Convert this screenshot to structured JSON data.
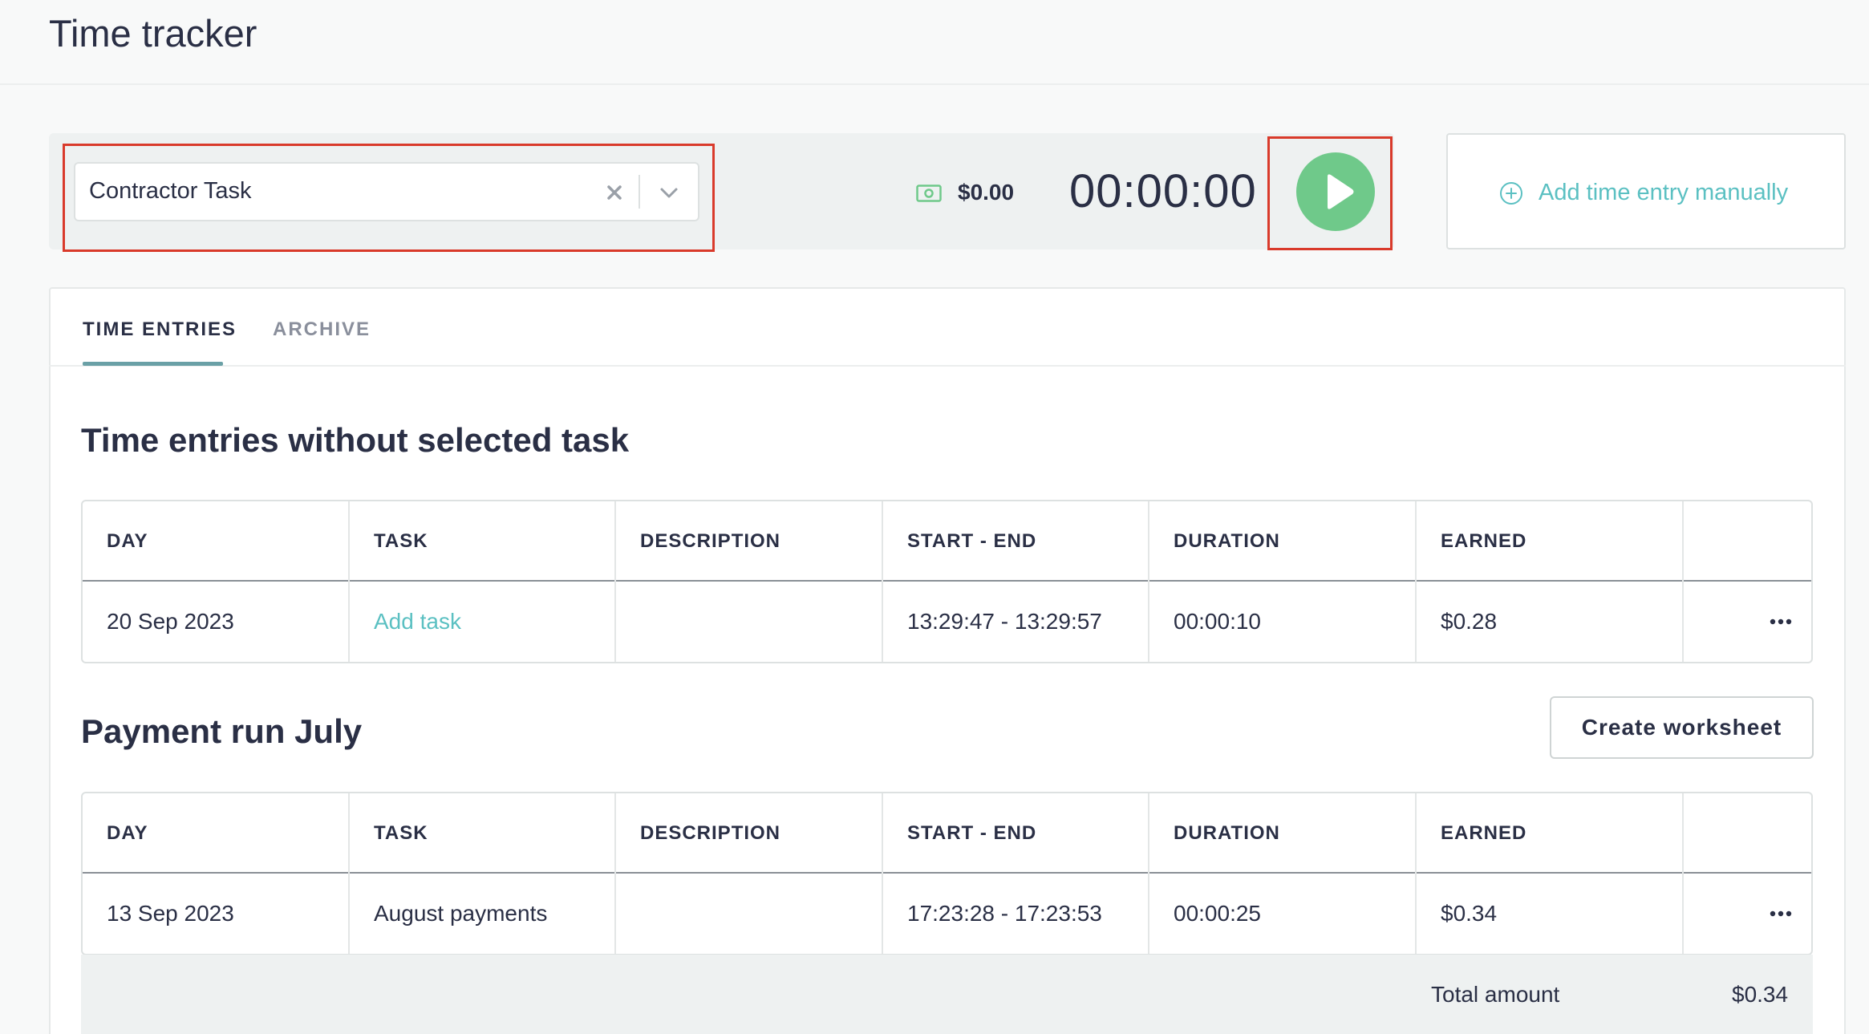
{
  "page": {
    "title": "Time tracker"
  },
  "timer": {
    "task_value": "Contractor Task",
    "earned": "$0.00",
    "elapsed": "00:00:00",
    "add_manual_label": "Add time entry manually"
  },
  "tabs": [
    {
      "label": "TIME ENTRIES",
      "active": true
    },
    {
      "label": "ARCHIVE",
      "active": false
    }
  ],
  "sections": [
    {
      "title": "Time entries without selected task",
      "columns": [
        "DAY",
        "TASK",
        "DESCRIPTION",
        "START - END",
        "DURATION",
        "EARNED"
      ],
      "rows": [
        {
          "day": "20 Sep 2023",
          "task": "Add task",
          "description": "",
          "start_end": "13:29:47 - 13:29:57",
          "duration": "00:00:10",
          "earned": "$0.28"
        }
      ]
    },
    {
      "title": "Payment run July",
      "action_label": "Create worksheet",
      "columns": [
        "DAY",
        "TASK",
        "DESCRIPTION",
        "START - END",
        "DURATION",
        "EARNED"
      ],
      "rows": [
        {
          "day": "13 Sep 2023",
          "task": "August payments",
          "description": "",
          "start_end": "17:23:28 - 17:23:53",
          "duration": "00:00:25",
          "earned": "$0.34"
        }
      ],
      "total_label": "Total amount",
      "total_value": "$0.34"
    }
  ],
  "colors": {
    "accent": "#5bc0c2",
    "play": "#6fc98a",
    "highlight": "#d93a2b"
  }
}
